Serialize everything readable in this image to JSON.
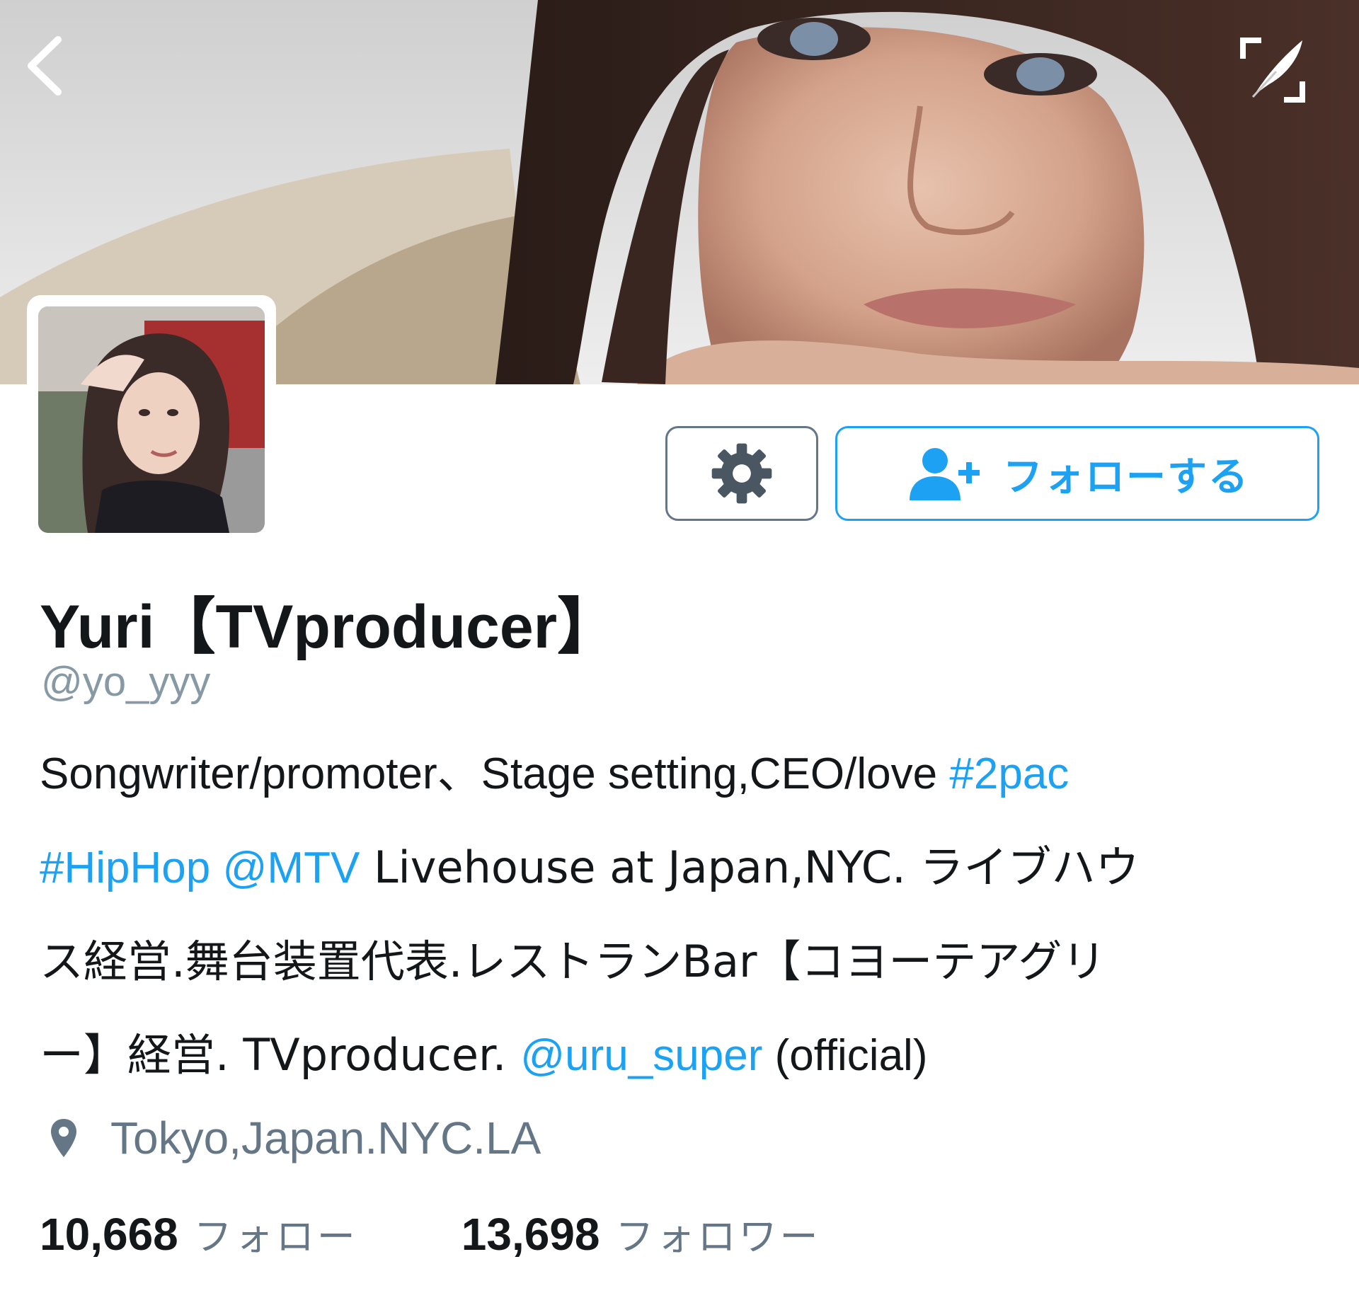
{
  "header": {
    "back_icon": "chevron-left-icon",
    "expand_icon": "expand-feather-icon"
  },
  "profile": {
    "display_name": "Yuri【TVproducer】",
    "screen_name": "@yo_yyy",
    "bio_lines": [
      [
        {
          "text": "Songwriter/promoter、Stage setting,CEO/love ",
          "link": false
        },
        {
          "text": "#2pac",
          "link": true
        }
      ],
      [
        {
          "text": "#HipHop",
          "link": true
        },
        {
          "text": " ",
          "link": false
        },
        {
          "text": "@MTV",
          "link": true
        },
        {
          "text": " Livehouse at Japan,NYC. ライブハウ",
          "link": false
        }
      ],
      [
        {
          "text": "ス経営.舞台装置代表.レストランBar【コヨーテアグリ",
          "link": false
        }
      ],
      [
        {
          "text": "ー】経営. TVproducer. ",
          "link": false
        },
        {
          "text": "@uru_super",
          "link": true
        },
        {
          "text": " (official)",
          "link": false
        }
      ]
    ],
    "location": "Tokyo,Japan.NYC.LA",
    "location_icon": "location-pin-icon"
  },
  "actions": {
    "settings_icon": "gear-icon",
    "follow_icon": "add-user-icon",
    "follow_label": "フォローする"
  },
  "stats": {
    "following_count": "10,668",
    "following_label": "フォロー",
    "followers_count": "13,698",
    "followers_label": "フォロワー"
  },
  "colors": {
    "accent": "#1da1f2",
    "text_primary": "#14171a",
    "text_secondary": "#657786",
    "screen_name": "#8899a6"
  }
}
